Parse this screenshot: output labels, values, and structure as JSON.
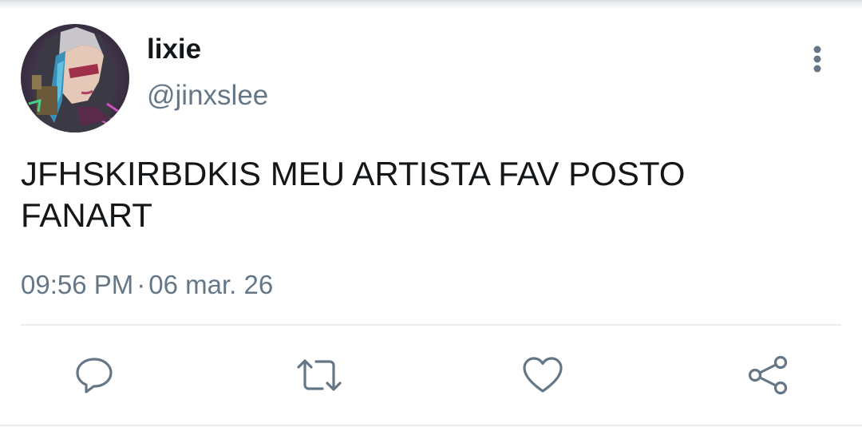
{
  "tweet": {
    "author": {
      "display_name": "lixie",
      "handle": "@jinxslee",
      "avatar": "profile-avatar"
    },
    "text": "JFHSKIRBDKIS MEU ARTISTA FAV POSTO FANART",
    "time": "09:56 PM",
    "separator": "·",
    "date": "06 mar. 26"
  },
  "actions": [
    {
      "name": "reply",
      "icon": "speech-bubble-icon"
    },
    {
      "name": "retweet",
      "icon": "retweet-icon"
    },
    {
      "name": "like",
      "icon": "heart-icon"
    },
    {
      "name": "share",
      "icon": "share-icon"
    }
  ],
  "menu": {
    "icon": "more-vertical-icon"
  },
  "colors": {
    "text_primary": "#14171a",
    "text_secondary": "#657786",
    "divider": "#e6ecf0",
    "icon": "#657786"
  }
}
